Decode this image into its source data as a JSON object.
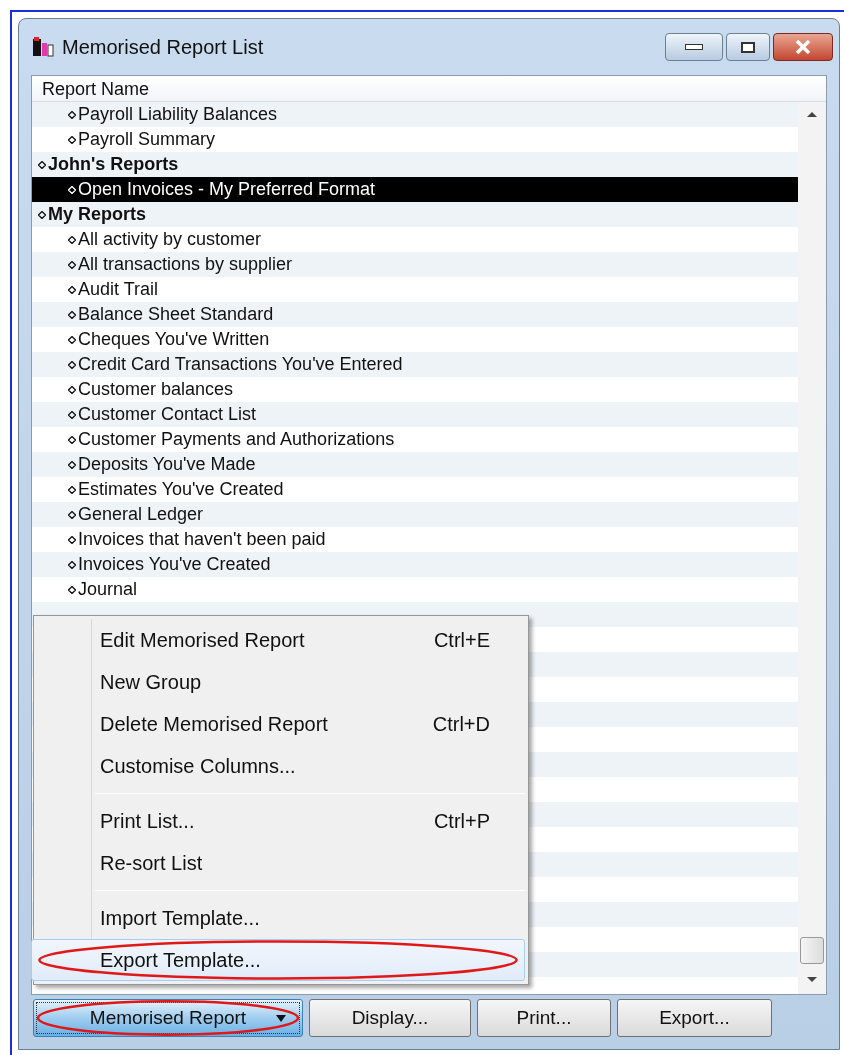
{
  "window": {
    "title": "Memorised Report List"
  },
  "list": {
    "column_header": "Report Name",
    "rows": [
      {
        "kind": "report",
        "label": "Payroll Liability Balances",
        "selected": false
      },
      {
        "kind": "report",
        "label": "Payroll Summary",
        "selected": false
      },
      {
        "kind": "group",
        "label": "John's Reports",
        "selected": false
      },
      {
        "kind": "report",
        "label": "Open Invoices - My Preferred Format",
        "selected": true
      },
      {
        "kind": "group",
        "label": "My Reports",
        "selected": false
      },
      {
        "kind": "report",
        "label": "All activity by customer",
        "selected": false
      },
      {
        "kind": "report",
        "label": "All transactions by supplier",
        "selected": false
      },
      {
        "kind": "report",
        "label": "Audit Trail",
        "selected": false
      },
      {
        "kind": "report",
        "label": "Balance Sheet Standard",
        "selected": false
      },
      {
        "kind": "report",
        "label": "Cheques You've Written",
        "selected": false
      },
      {
        "kind": "report",
        "label": "Credit Card Transactions You've Entered",
        "selected": false
      },
      {
        "kind": "report",
        "label": "Customer balances",
        "selected": false
      },
      {
        "kind": "report",
        "label": "Customer Contact List",
        "selected": false
      },
      {
        "kind": "report",
        "label": "Customer Payments and Authorizations",
        "selected": false
      },
      {
        "kind": "report",
        "label": "Deposits You've Made",
        "selected": false
      },
      {
        "kind": "report",
        "label": "Estimates You've Created",
        "selected": false
      },
      {
        "kind": "report",
        "label": "General Ledger",
        "selected": false
      },
      {
        "kind": "report",
        "label": "Invoices that haven't been paid",
        "selected": false
      },
      {
        "kind": "report",
        "label": "Invoices You've Created",
        "selected": false
      },
      {
        "kind": "report",
        "label": "Journal",
        "selected": false
      }
    ]
  },
  "menu": {
    "groups": [
      [
        {
          "label": "Edit Memorised Report",
          "shortcut": "Ctrl+E",
          "selected": false,
          "circled": false
        },
        {
          "label": "New Group",
          "selected": false,
          "circled": false
        },
        {
          "label": "Delete Memorised Report",
          "shortcut": "Ctrl+D",
          "selected": false,
          "circled": false
        },
        {
          "label": "Customise Columns...",
          "selected": false,
          "circled": false
        }
      ],
      [
        {
          "label": "Print List...",
          "shortcut": "Ctrl+P",
          "selected": false,
          "circled": false
        },
        {
          "label": "Re-sort List",
          "selected": false,
          "circled": false
        }
      ],
      [
        {
          "label": "Import Template...",
          "selected": false,
          "circled": false
        },
        {
          "label": "Export Template...",
          "selected": true,
          "circled": true
        }
      ]
    ]
  },
  "buttons": [
    {
      "label": "Memorised Report",
      "kind": "dropdown",
      "selected": true,
      "circled": true
    },
    {
      "label": "Display...",
      "kind": "plain",
      "selected": false,
      "circled": false
    },
    {
      "label": "Print...",
      "kind": "plain",
      "selected": false,
      "circled": false
    },
    {
      "label": "Export...",
      "kind": "plain",
      "selected": false,
      "circled": false
    }
  ]
}
